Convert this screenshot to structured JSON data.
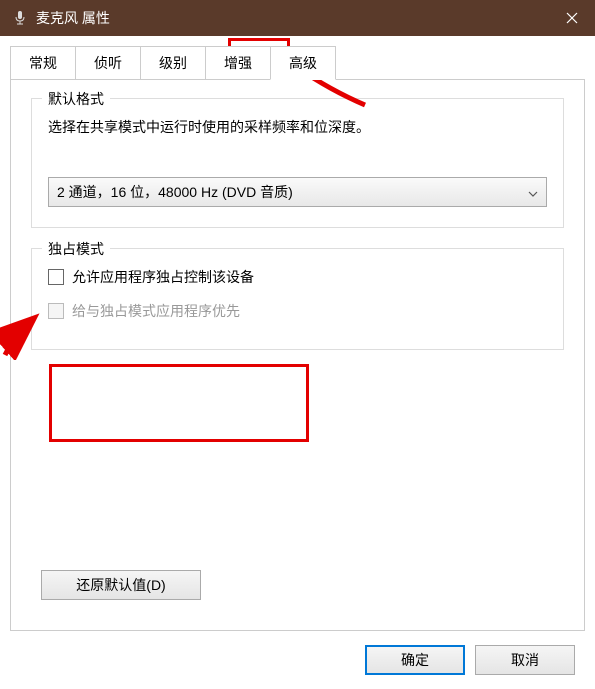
{
  "window": {
    "title": "麦克风 属性"
  },
  "tabs": {
    "items": [
      {
        "label": "常规"
      },
      {
        "label": "侦听"
      },
      {
        "label": "级别"
      },
      {
        "label": "增强"
      },
      {
        "label": "高级"
      }
    ]
  },
  "defaultFormat": {
    "title": "默认格式",
    "description": "选择在共享模式中运行时使用的采样频率和位深度。",
    "selected": "2 通道，16 位，48000 Hz (DVD 音质)"
  },
  "exclusiveMode": {
    "title": "独占模式",
    "allowExclusive": "允许应用程序独占控制该设备",
    "givePriority": "给与独占模式应用程序优先"
  },
  "buttons": {
    "restore": "还原默认值(D)",
    "ok": "确定",
    "cancel": "取消"
  }
}
